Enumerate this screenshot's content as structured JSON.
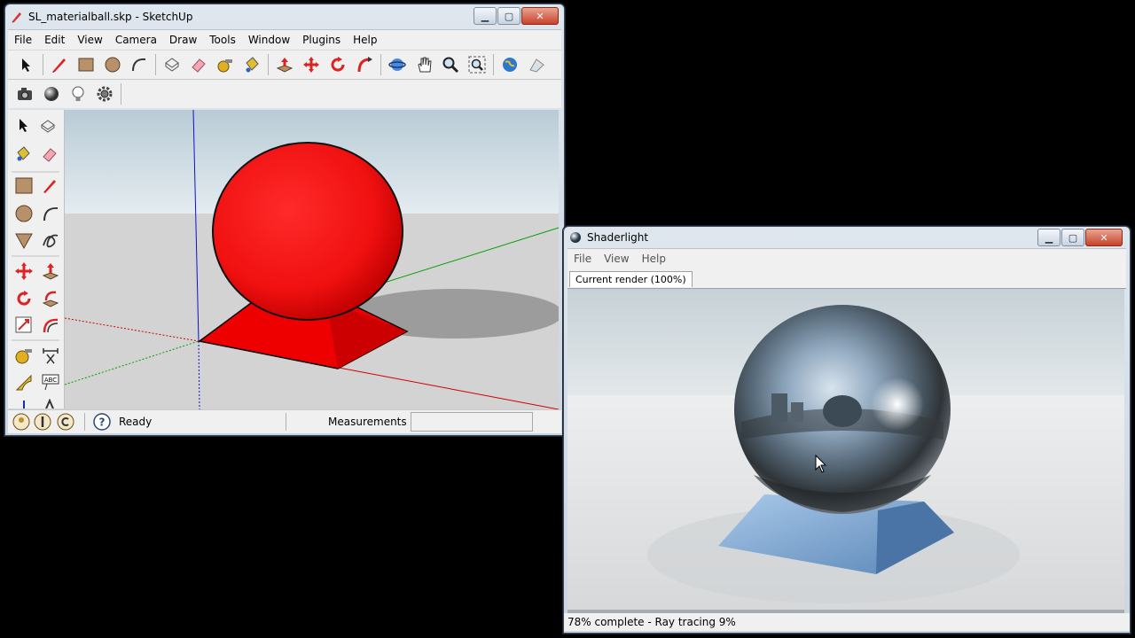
{
  "sketchup": {
    "title": "SL_materialball.skp - SketchUp",
    "window_buttons": [
      "minimize-button",
      "maximize-button",
      "close-button"
    ],
    "menu": [
      "File",
      "Edit",
      "View",
      "Camera",
      "Draw",
      "Tools",
      "Window",
      "Plugins",
      "Help"
    ],
    "status_text": "Ready",
    "measurements_label": "Measurements",
    "measurements_value": ""
  },
  "shaderlight": {
    "title": "Shaderlight",
    "menu": [
      "File",
      "View",
      "Help"
    ],
    "tab_label": "Current render (100%)",
    "status_text": "78% complete - Ray tracing 9%"
  },
  "colors": {
    "ball_red": "#ff1a1a",
    "sky": "#c8d4da",
    "ground": "#d2d2d2",
    "render_floor": "#e7e9ea"
  }
}
